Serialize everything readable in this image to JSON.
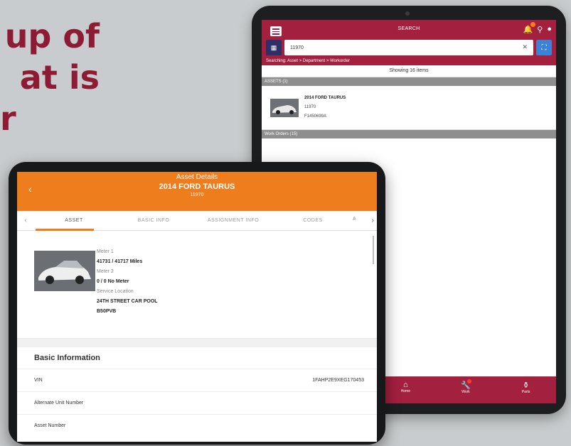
{
  "headline": {
    "line1": "up of",
    "line2": "at is",
    "line3": "r"
  },
  "back_app": {
    "title": "SEARCH",
    "search_value": "11970",
    "breadcrumb": "Searching: Asset > Department > Workorder",
    "showing": "Showing 16 items",
    "assets_header": "ASSETS (1)",
    "asset": {
      "name": "2014 FORD TAURUS",
      "number": "11970",
      "plate": "F1450699A"
    },
    "workorders_header": "Work Orders (15)",
    "nav": [
      {
        "label": "Home",
        "icon": "home-icon"
      },
      {
        "label": "Work",
        "icon": "wrench-icon"
      },
      {
        "label": "Parts",
        "icon": "parts-icon"
      }
    ],
    "colors": {
      "primary": "#a3203f",
      "accent": "#3e82d6"
    }
  },
  "front_app": {
    "header": {
      "title": "Asset Details",
      "name": "2014 FORD TAURUS",
      "number": "11970"
    },
    "tabs": [
      "ASSET",
      "BASIC INFO",
      "ASSIGNMENT INFO",
      "CODES",
      "A"
    ],
    "details": {
      "meter1_label": "Meter 1",
      "meter1_value": "41731 / 41717 Miles",
      "meter2_label": "Meter 2",
      "meter2_value": "0 / 0 No Meter",
      "service_label": "Service Location",
      "service_value": "24TH STREET CAR POOL",
      "service_code": "B50PVB"
    },
    "basic_info": {
      "title": "Basic Information",
      "rows": [
        {
          "label": "VIN",
          "value": "1FAHP2E9XEG170453"
        },
        {
          "label": "Alternate Unit Number",
          "value": ""
        },
        {
          "label": "Asset Number",
          "value": ""
        }
      ]
    },
    "colors": {
      "primary": "#ee7d1e"
    }
  }
}
